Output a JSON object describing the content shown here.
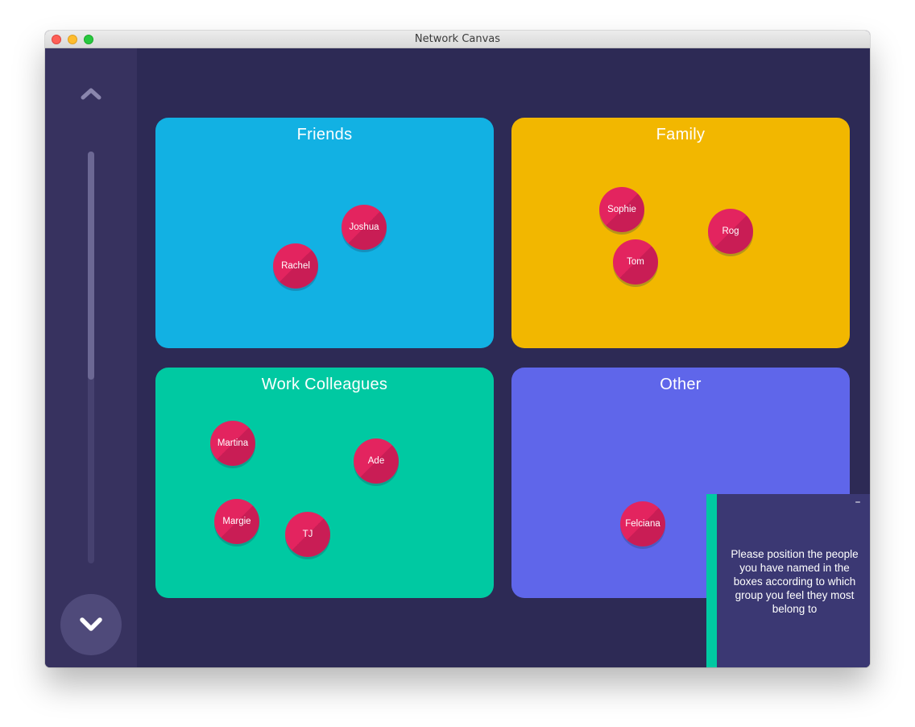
{
  "window": {
    "title": "Network Canvas"
  },
  "colors": {
    "background": "#2d2a55",
    "sidebar": "#37325f",
    "node": "#e3245f",
    "prompt_accent": "#00c9a2"
  },
  "sidebar": {
    "up_icon": "chevron-up-icon",
    "down_icon": "chevron-down-icon"
  },
  "boxes": [
    {
      "label": "Friends",
      "color": "#12b1e3",
      "nodes": [
        "Joshua",
        "Rachel"
      ]
    },
    {
      "label": "Family",
      "color": "#f2b700",
      "nodes": [
        "Sophie",
        "Tom",
        "Rog"
      ]
    },
    {
      "label": "Work Colleagues",
      "color": "#00c9a2",
      "nodes": [
        "Martina",
        "Ade",
        "Margie",
        "TJ"
      ]
    },
    {
      "label": "Other",
      "color": "#5f66ea",
      "nodes": [
        "Felciana"
      ]
    }
  ],
  "prompt": {
    "text": "Please position the people you have named in the boxes according to which group you feel they most belong to",
    "minimize_label": "–"
  }
}
